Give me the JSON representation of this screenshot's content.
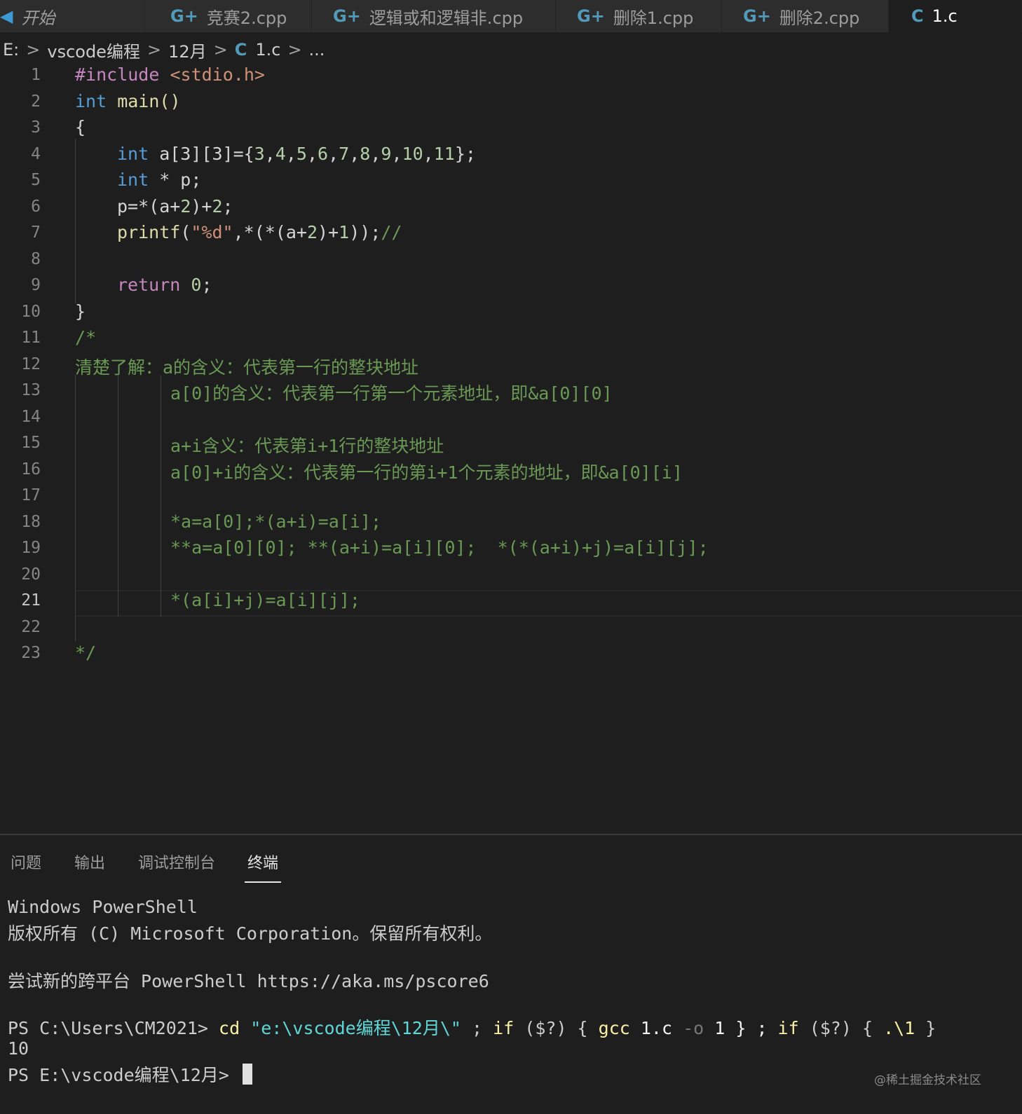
{
  "tabs": [
    {
      "icon": "vscode-icon",
      "label": "开始",
      "active": false
    },
    {
      "icon": "cpp-file-icon",
      "label": "竞赛2.cpp",
      "active": false
    },
    {
      "icon": "cpp-file-icon",
      "label": "逻辑或和逻辑非.cpp",
      "active": false
    },
    {
      "icon": "cpp-file-icon",
      "label": "删除1.cpp",
      "active": false
    },
    {
      "icon": "cpp-file-icon",
      "label": "删除2.cpp",
      "active": false
    },
    {
      "icon": "c-file-icon",
      "label": "1.c",
      "active": true
    }
  ],
  "icon_glyphs": {
    "cpp": "G+",
    "c": "C",
    "vscode": "◀"
  },
  "breadcrumb": {
    "drive": "E:",
    "folder1": "vscode编程",
    "folder2": "12月",
    "file": "1.c",
    "more": "...",
    "sep": ">"
  },
  "line_numbers": [
    "1",
    "2",
    "3",
    "4",
    "5",
    "6",
    "7",
    "8",
    "9",
    "10",
    "11",
    "12",
    "13",
    "14",
    "15",
    "16",
    "17",
    "18",
    "19",
    "20",
    "21",
    "22",
    "23"
  ],
  "current_line": 21,
  "code": {
    "l1a": "#include",
    "l1b": " <stdio.h>",
    "l2a": "int",
    "l2b": " main()",
    "l3": "{",
    "l4a": "int",
    "l4b": " a[3][3]={",
    "l4c": "3",
    "l4d": ",",
    "l4e": "4",
    "l4f": ",",
    "l4g": "5",
    "l4h": ",",
    "l4i": "6",
    "l4j": ",",
    "l4k": "7",
    "l4l": ",",
    "l4m": "8",
    "l4n": ",",
    "l4o": "9",
    "l4p": ",",
    "l4q": "10",
    "l4r": ",",
    "l4s": "11",
    "l4t": "};",
    "l5a": "int",
    "l5b": " * p;",
    "l6a": "p=*(a+",
    "l6b": "2",
    "l6c": ")+",
    "l6d": "2",
    "l6e": ";",
    "l7a": "printf",
    "l7b": "(",
    "l7c": "\"%d\"",
    "l7d": ",*(*(a+",
    "l7e": "2",
    "l7f": ")+",
    "l7g": "1",
    "l7h": "));",
    "l7i": "//",
    "l9a": "return",
    "l9b": " ",
    "l9c": "0",
    "l9d": ";",
    "l10": "}",
    "l11": "/*",
    "l12": "清楚了解：a的含义：代表第一行的整块地址",
    "l13": "a[0]的含义：代表第一行第一个元素地址，即&a[0][0]",
    "l15": "a+i含义：代表第i+1行的整块地址",
    "l16": "a[0]+i的含义：代表第一行的第i+1个元素的地址，即&a[0][i]",
    "l18": "*a=a[0];*(a+i)=a[i];",
    "l19": "**a=a[0][0]; **(a+i)=a[i][0];  *(*(a+i)+j)=a[i][j];",
    "l21": "*(a[i]+j)=a[i][j];",
    "l23": "*/"
  },
  "panel": {
    "tabs": [
      {
        "label": "问题",
        "active": false
      },
      {
        "label": "输出",
        "active": false
      },
      {
        "label": "调试控制台",
        "active": false
      },
      {
        "label": "终端",
        "active": true
      }
    ]
  },
  "terminal": {
    "line1": "Windows PowerShell",
    "line2": "版权所有 (C) Microsoft Corporation。保留所有权利。",
    "line3": "尝试新的跨平台 PowerShell https://aka.ms/pscore6",
    "prompt1": "PS C:\\Users\\CM2021> ",
    "cmd_cd": "cd",
    "cmd_path": " \"e:\\vscode编程\\12月\\\"",
    "cmd_semi1": " ; ",
    "cmd_if1": "if",
    "cmd_cond1": " ($?) { ",
    "cmd_gcc": "gcc",
    "cmd_file": " 1.c ",
    "cmd_o": "-o",
    "cmd_out": " 1 } ; ",
    "cmd_if2": "if",
    "cmd_cond2": " ($?) { ",
    "cmd_run": ".\\1",
    "cmd_end": " }",
    "output": "10",
    "prompt2": "PS E:\\vscode编程\\12月> "
  },
  "watermark": "@稀土掘金技术社区"
}
